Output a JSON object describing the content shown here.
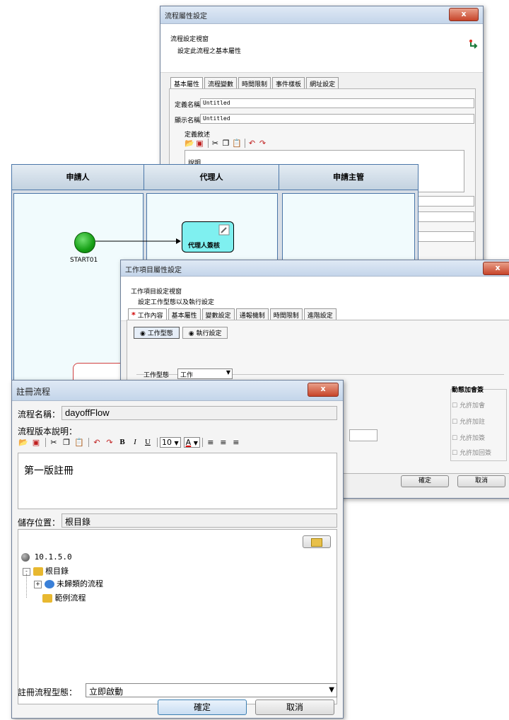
{
  "w1": {
    "title": "流程屬性設定",
    "close": "x",
    "header_title": "流程設定視窗",
    "header_sub": "設定此流程之基本屬性",
    "tabs": [
      "基本屬性",
      "流程變數",
      "時間限制",
      "事件樣板",
      "網址設定"
    ],
    "def_name_label": "定義名稱",
    "def_name_value": "Untitled",
    "disp_name_label": "顯示名稱",
    "disp_name_value": "Untitled",
    "desc_label": "定義敘述",
    "desc_value": "說明"
  },
  "diagram": {
    "lanes": [
      "申請人",
      "代理人",
      "申請主管"
    ],
    "start_label": "START01",
    "activity_label": "代理人簽核"
  },
  "w2": {
    "title": "工作項目屬性設定",
    "close": "x",
    "header_title": "工作項目設定視窗",
    "header_sub": "設定工作型態以及執行設定",
    "required_mark": "*",
    "tabs": [
      "工作內容",
      "基本屬性",
      "變數設定",
      "通報機制",
      "時間限制",
      "進階設定"
    ],
    "radio_work_type": "工作型態",
    "radio_exec": "執行設定",
    "work_type_label": "工作型態",
    "work_type_value": "工作",
    "dynamic_title": "動態加會簽",
    "options": [
      "允許加會",
      "允許加註",
      "允許加簽",
      "允許加回簽"
    ],
    "ok": "確定",
    "cancel": "取消"
  },
  "w3": {
    "title": "註冊流程",
    "close": "x",
    "name_label": "流程名稱：",
    "name_value": "dayoffFlow",
    "version_label": "流程版本說明：",
    "font_size": "10",
    "desc_text": "第一版註冊",
    "location_label": "儲存位置：",
    "location_value": "根目錄",
    "tree": {
      "server": "10.1.5.0",
      "root": "根目錄",
      "uncategorized": "未歸類的流程",
      "sample": "範例流程"
    },
    "type_label": "註冊流程型態：",
    "type_value": "立即啟動",
    "ok": "確定",
    "cancel": "取消"
  },
  "colors": {
    "lane_header": "#d2dde8",
    "lane_body": "#f1fbfd",
    "lane_border": "#3a6aa0",
    "activity_fill": "#7ff0f0",
    "start_fill": "#22b022",
    "required": "#d00000"
  }
}
